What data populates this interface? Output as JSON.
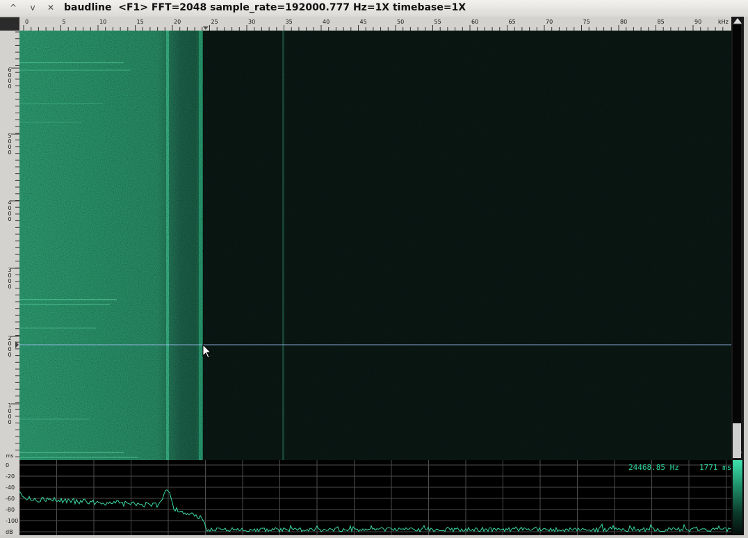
{
  "window": {
    "title": "baudline  <F1> FFT=2048 sample_rate=192000.777 Hz=1X timebase=1X",
    "controls": [
      {
        "name": "maximize",
        "glyph": "^"
      },
      {
        "name": "minimize",
        "glyph": "v"
      },
      {
        "name": "close",
        "glyph": "✕"
      }
    ]
  },
  "freq_axis": {
    "unit": "kHz",
    "tick_labels": [
      "0",
      "5",
      "10",
      "15",
      "20",
      "25",
      "30",
      "35",
      "40",
      "45",
      "50",
      "55",
      "60",
      "65",
      "70",
      "75",
      "80",
      "85",
      "90"
    ],
    "max_khz": 96,
    "cursor_khz": 24.47
  },
  "time_axis": {
    "unit": "ms",
    "tick_labels": [
      "6000",
      "5000",
      "4000",
      "3000",
      "2000",
      "1000"
    ]
  },
  "db_axis": {
    "unit": "dB",
    "tick_labels": [
      "0",
      "-20",
      "-40",
      "-60",
      "-80",
      "-100"
    ]
  },
  "readout": {
    "frequency": "24468.85 Hz",
    "time": "1771 ms"
  },
  "scrollbar": {
    "position_fraction": 0.95
  },
  "colors": {
    "spectrogram_low": "#0a1814",
    "spectrogram_high": "#2e9c72",
    "trace": "#3bd9a3",
    "grid": "#5a5a5a",
    "cursor_line": "#a8c6ff"
  }
}
